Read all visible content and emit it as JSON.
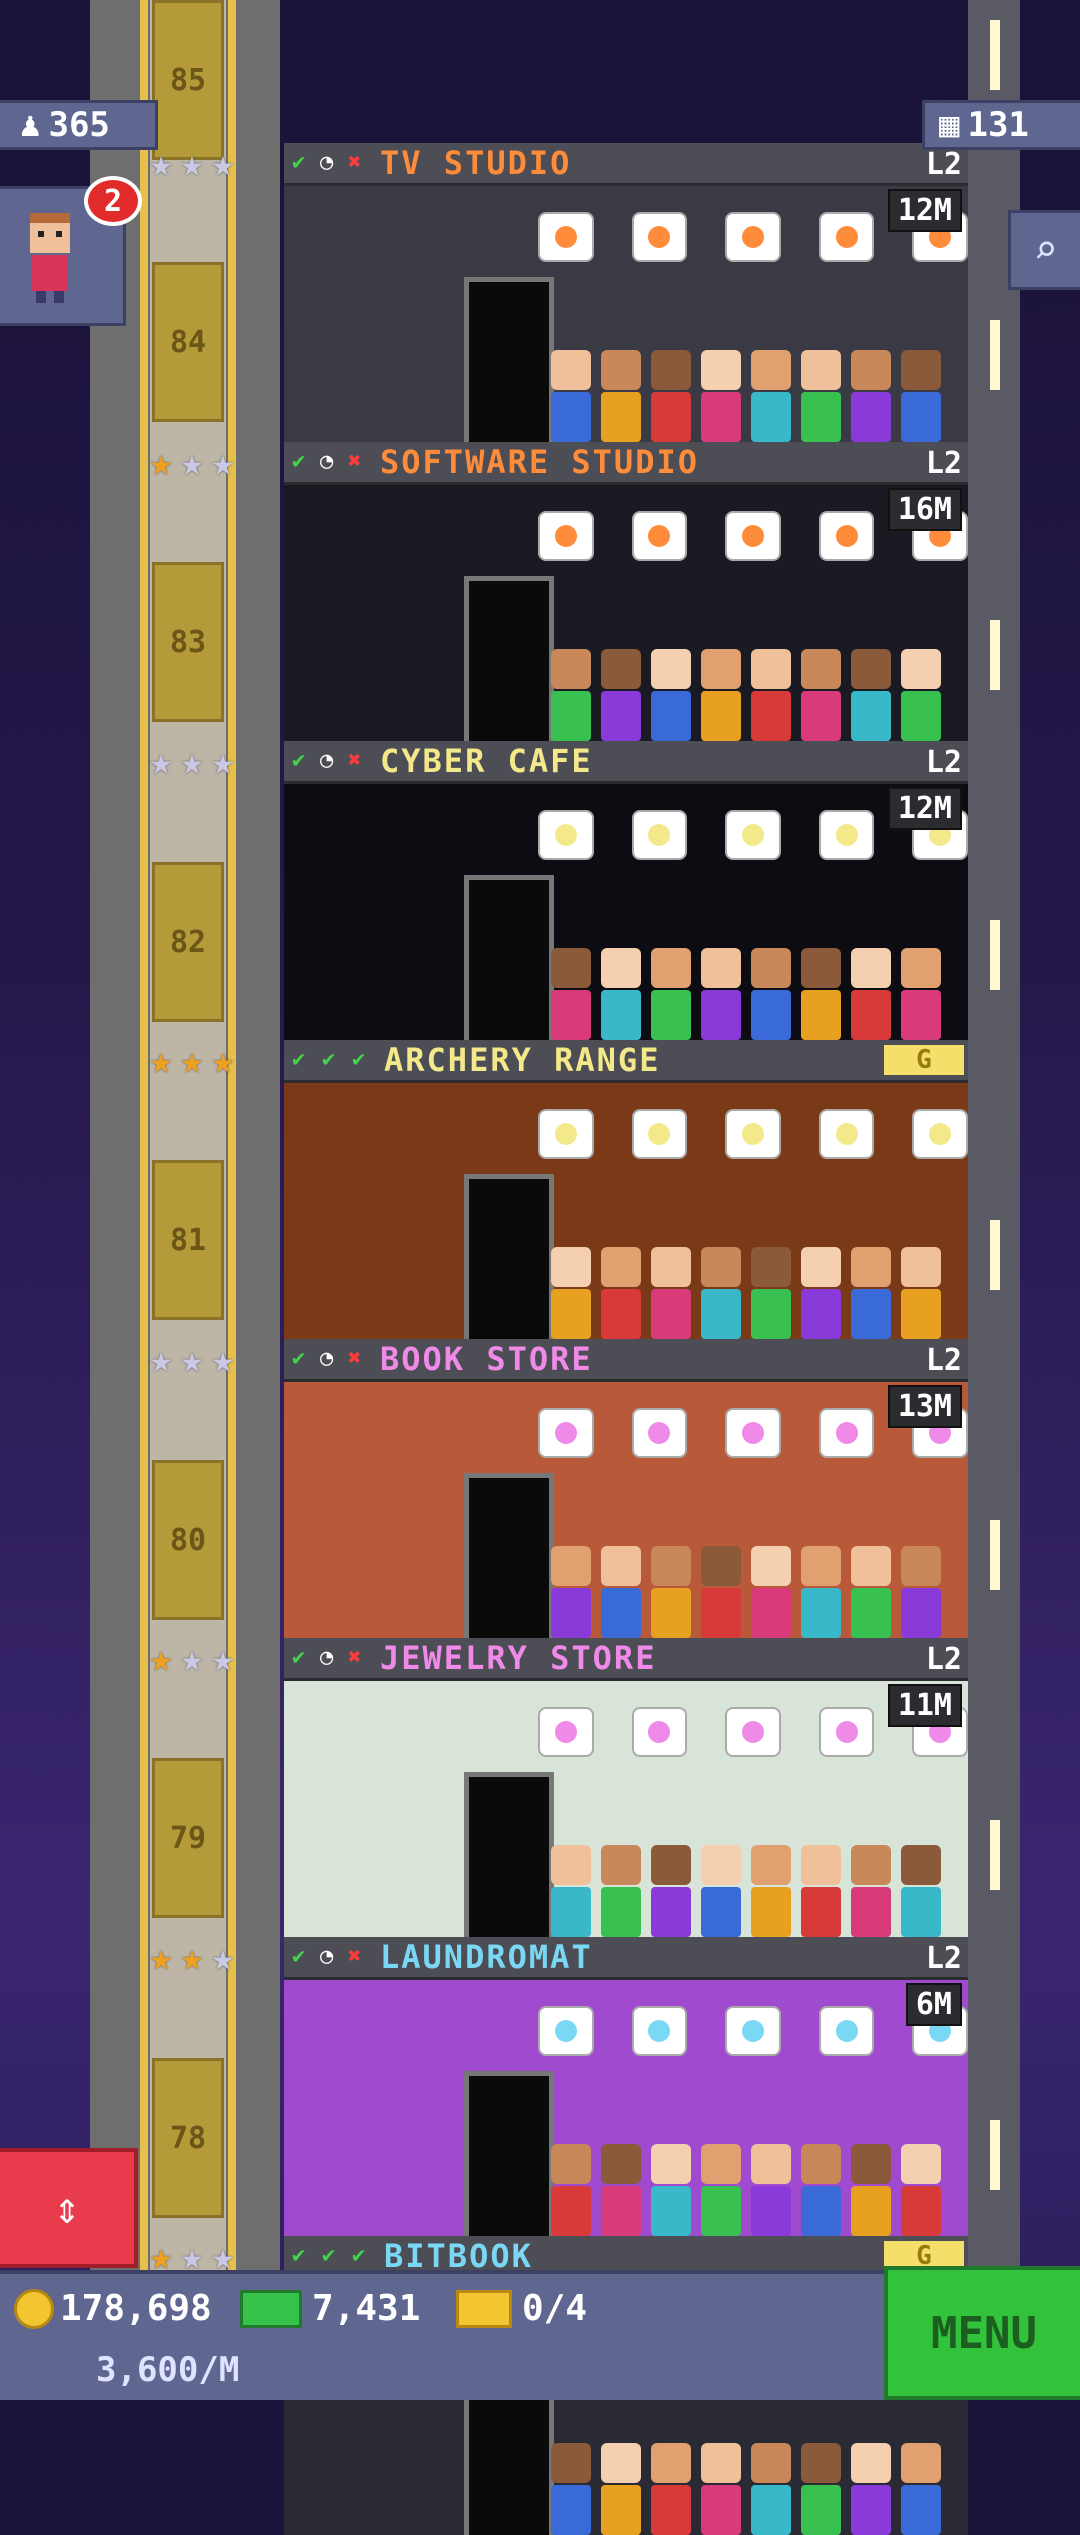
{
  "hud": {
    "population": "365",
    "floors": "131",
    "visitor_notifications": "2",
    "coins": "178,698",
    "bux": "7,431",
    "tickets": "0/4",
    "rate": "3,600/M",
    "menu_label": "MENU"
  },
  "elevator_floors": [
    "85",
    "84",
    "83",
    "82",
    "81",
    "80",
    "79",
    "78"
  ],
  "floors": [
    {
      "name": "TV STUDIO",
      "color": "#ff8c3a",
      "level": "L2",
      "money": "12M",
      "status": [
        "check",
        "clock",
        "x"
      ],
      "stars": 0
    },
    {
      "name": "SOFTWARE STUDIO",
      "color": "#ff8c3a",
      "level": "L2",
      "money": "16M",
      "status": [
        "check",
        "clock",
        "x"
      ],
      "stars": 1
    },
    {
      "name": "CYBER CAFE",
      "color": "#f3e98a",
      "level": "L2",
      "money": "12M",
      "status": [
        "check",
        "clock",
        "x"
      ],
      "stars": 0
    },
    {
      "name": "ARCHERY RANGE",
      "color": "#f3e98a",
      "level": "G",
      "money": "",
      "status": [
        "check",
        "check",
        "check"
      ],
      "stars": 3
    },
    {
      "name": "BOOK STORE",
      "color": "#f08ae8",
      "level": "L2",
      "money": "13M",
      "status": [
        "check",
        "clock",
        "x"
      ],
      "stars": 0
    },
    {
      "name": "JEWELRY STORE",
      "color": "#f08ae8",
      "level": "L2",
      "money": "11M",
      "status": [
        "check",
        "clock",
        "x"
      ],
      "stars": 1
    },
    {
      "name": "LAUNDROMAT",
      "color": "#7ad8f5",
      "level": "L2",
      "money": "6M",
      "status": [
        "check",
        "clock",
        "x"
      ],
      "stars": 2
    },
    {
      "name": "BITBOOK",
      "color": "#7ad8f5",
      "level": "G",
      "money": "",
      "status": [
        "check",
        "check",
        "check"
      ],
      "stars": 1
    }
  ],
  "colors": {
    "gold_star": "#f0a020",
    "silver_star": "#c9c9e6",
    "check": "#42d44a",
    "cancel": "#ff3b3b"
  }
}
